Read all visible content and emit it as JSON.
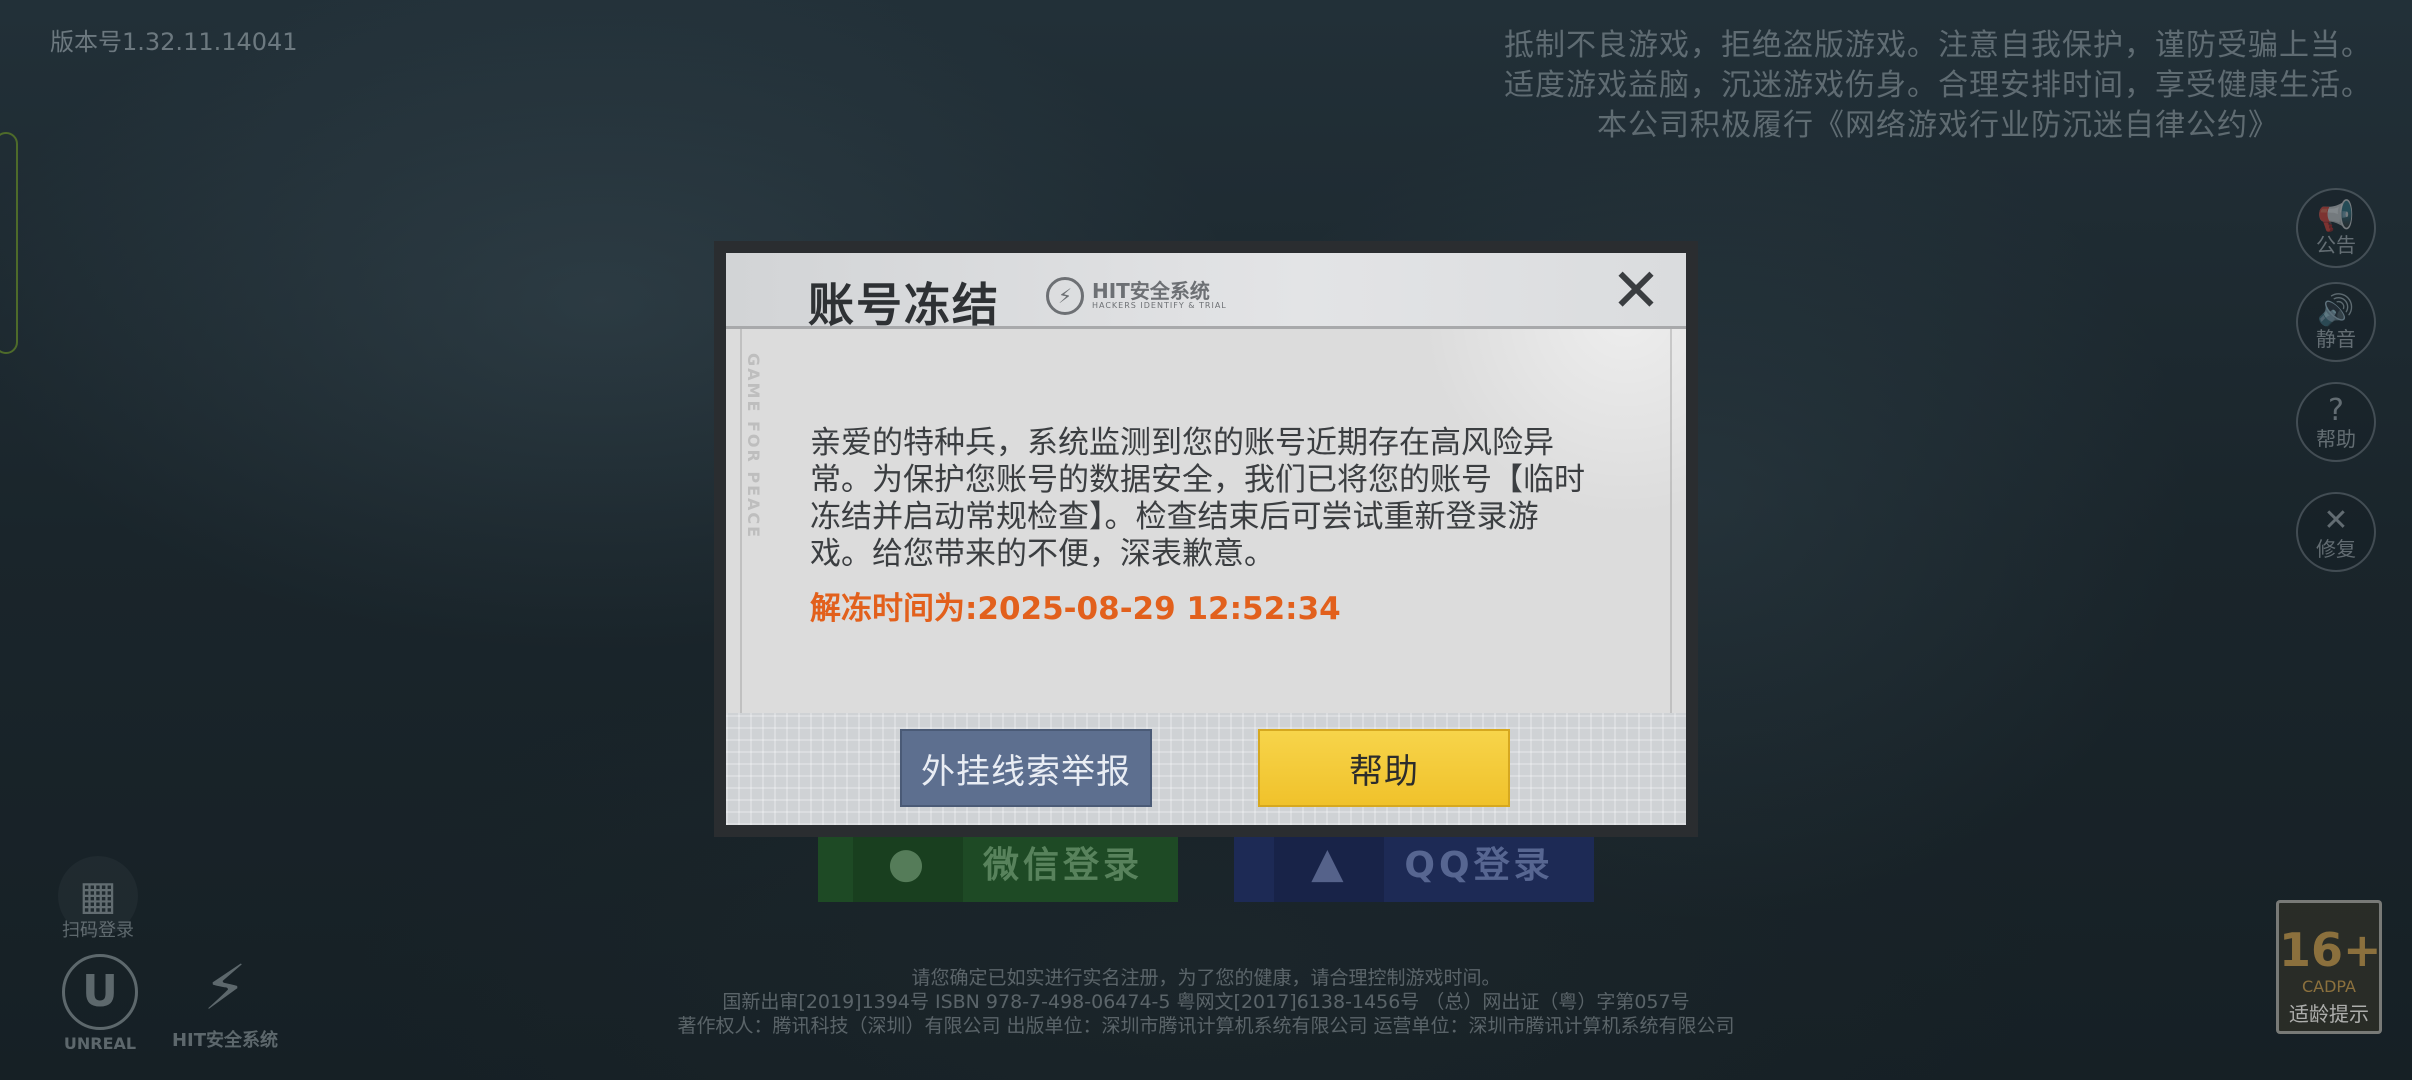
{
  "version": "版本号1.32.11.14041",
  "notice": {
    "line1": "抵制不良游戏，拒绝盗版游戏。注意自我保护，谨防受骗上当。",
    "line2": "适度游戏益脑，沉迷游戏伤身。合理安排时间，享受健康生活。",
    "line3": "本公司积极履行《网络游戏行业防沉迷自律公约》"
  },
  "side_buttons": [
    {
      "icon": "megaphone-icon",
      "label": "公告"
    },
    {
      "icon": "speaker-icon",
      "label": "静音"
    },
    {
      "icon": "question-icon",
      "label": "帮助"
    },
    {
      "icon": "wrench-icon",
      "label": "修复"
    }
  ],
  "qr_login": {
    "label": "扫码登录"
  },
  "logos": {
    "unreal": "UNREAL",
    "hit": "HIT安全系统"
  },
  "login": {
    "wechat": "微信登录",
    "qq": "QQ登录"
  },
  "footer": {
    "line1": "请您确定已如实进行实名注册，为了您的健康，请合理控制游戏时间。",
    "line2": "国新出审[2019]1394号  ISBN 978-7-498-06474-5  粤网文[2017]6138-1456号 （总）网出证（粤）字第057号",
    "line3": "著作权人：腾讯科技（深圳）有限公司   出版单位：深圳市腾讯计算机系统有限公司   运营单位：深圳市腾讯计算机系统有限公司"
  },
  "age_rating": {
    "age": "16+",
    "org": "CADPA",
    "label": "适龄提示"
  },
  "dialog": {
    "title": "账号冻结",
    "badge": "HIT安全系统",
    "badge_sub": "HACKERS IDENTIFY & TRIAL",
    "side_text": "GAME FOR PEACE",
    "close": "✕",
    "message": "亲爱的特种兵，系统监测到您的账号近期存在高风险异常。为保护您账号的数据安全，我们已将您的账号【临时冻结并启动常规检查】。检查结束后可尝试重新登录游戏。给您带来的不便，深表歉意。",
    "unfreeze_prefix": "解冻时间为:",
    "unfreeze_time": "2025-08-29 12:52:34",
    "report_button": "外挂线索举报",
    "help_button": "帮助"
  },
  "colors": {
    "unfreeze": "#e2601c",
    "report_button": "#5d6f8f",
    "help_button": "#f0c22b"
  }
}
